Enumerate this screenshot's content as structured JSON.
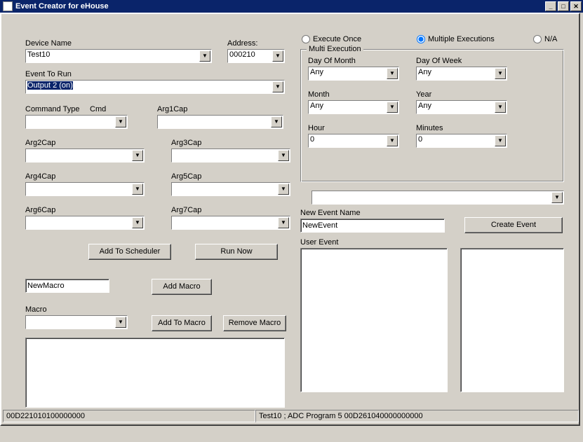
{
  "window": {
    "title": "Event Creator for eHouse",
    "min": "_",
    "max": "□",
    "close": "✕"
  },
  "labels": {
    "device_name": "Device Name",
    "address": "Address:",
    "event_to_run": "Event To Run",
    "command_type": "Command Type",
    "cmd": "Cmd",
    "arg1cap": "Arg1Cap",
    "arg2cap": "Arg2Cap",
    "arg3cap": "Arg3Cap",
    "arg4cap": "Arg4Cap",
    "arg5cap": "Arg5Cap",
    "arg6cap": "Arg6Cap",
    "arg7cap": "Arg7Cap",
    "macro": "Macro",
    "new_event_name": "New Event Name",
    "user_event": "User Event"
  },
  "buttons": {
    "add_to_scheduler": "Add To Scheduler",
    "run_now": "Run Now",
    "add_macro": "Add Macro",
    "add_to_macro": "Add To Macro",
    "remove_macro": "Remove Macro",
    "create_event": "Create Event"
  },
  "radios": {
    "execute_once": "Execute Once",
    "multiple": "Multiple Executions",
    "na": "N/A"
  },
  "multi": {
    "legend": "Multi Execution",
    "day_of_month": "Day Of Month",
    "day_of_week": "Day Of Week",
    "month": "Month",
    "year": "Year",
    "hour": "Hour",
    "minutes": "Minutes"
  },
  "values": {
    "device_name": "Test10",
    "address": "000210",
    "event_to_run": "Output 2 (on)",
    "command_type": "",
    "arg1": "",
    "arg2": "",
    "arg3": "",
    "arg4": "",
    "arg5": "",
    "arg6": "",
    "arg7": "",
    "new_macro": "NewMacro",
    "macro_sel": "",
    "day_of_month": "Any",
    "day_of_week": "Any",
    "month": "Any",
    "year": "Any",
    "hour": "0",
    "minutes": "0",
    "long_combo": "",
    "new_event_name": "NewEvent"
  },
  "status": {
    "pane1": "00D221010100000000",
    "pane2": "Test10 ; ADC Program 5 00D261040000000000"
  }
}
